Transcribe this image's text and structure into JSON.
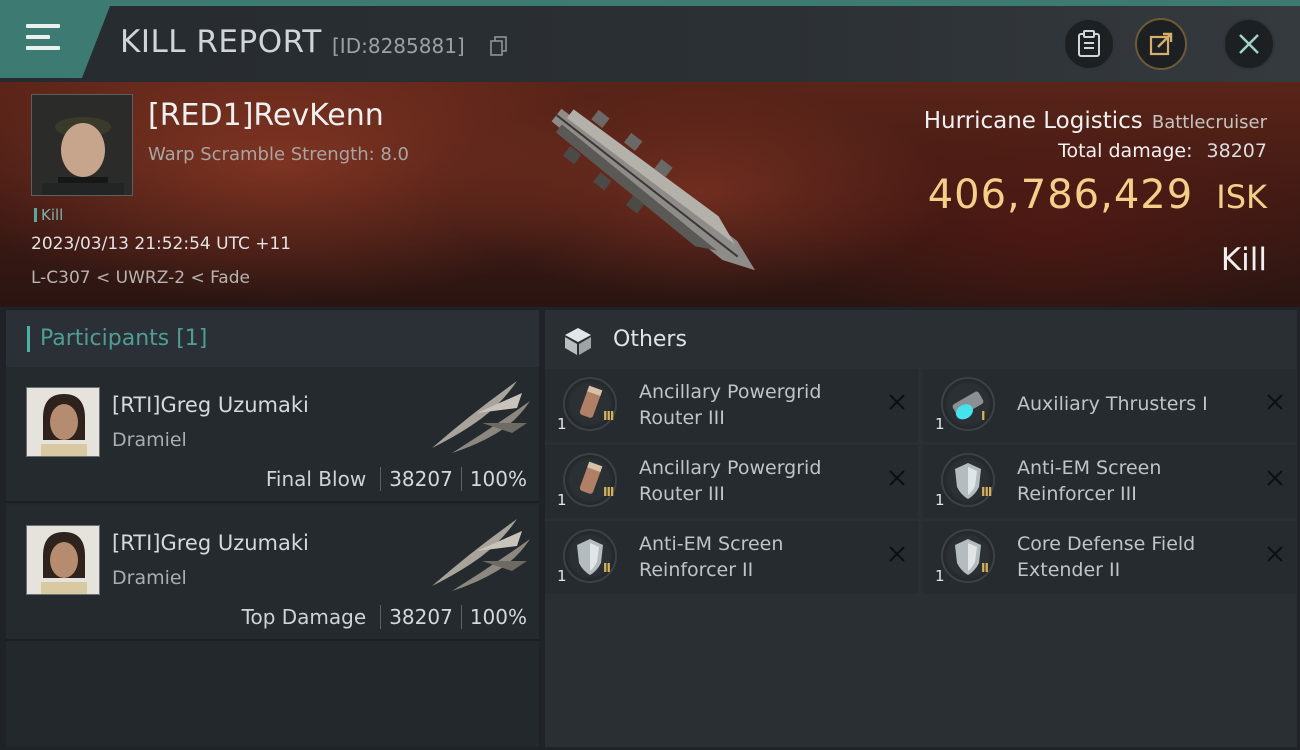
{
  "header": {
    "title": "KILL REPORT",
    "report_id": "[ID:8285881]",
    "icons": [
      "menu-icon",
      "copy-icon",
      "clipboard-icon",
      "share-icon",
      "close-icon"
    ]
  },
  "victim": {
    "name": "[RED1]RevKenn",
    "subtitle": "Warp Scramble Strength: 8.0",
    "tag": "Kill",
    "timestamp": "2023/03/13 21:52:54 UTC +11",
    "location": "L-C307 < UWRZ-2 < Fade"
  },
  "ship": {
    "name": "Hurricane Logistics",
    "class": "Battlecruiser",
    "total_damage_label": "Total damage:",
    "total_damage_value": "38207",
    "isk_value": "406,786,429",
    "isk_unit": "ISK",
    "result": "Kill"
  },
  "participants": {
    "title": "Participants [1]",
    "items": [
      {
        "name": "[RTI]Greg Uzumaki",
        "ship": "Dramiel",
        "role": "Final Blow",
        "damage": "38207",
        "percent": "100%"
      },
      {
        "name": "[RTI]Greg Uzumaki",
        "ship": "Dramiel",
        "role": "Top Damage",
        "damage": "38207",
        "percent": "100%"
      }
    ]
  },
  "others": {
    "title": "Others",
    "items": [
      {
        "name": "Ancillary Powergrid Router III",
        "qty": "1",
        "tier": "III",
        "icon": "powergrid-router-icon"
      },
      {
        "name": "Auxiliary Thrusters I",
        "qty": "1",
        "tier": "I",
        "icon": "thruster-icon"
      },
      {
        "name": "Ancillary Powergrid Router III",
        "qty": "1",
        "tier": "III",
        "icon": "powergrid-router-icon"
      },
      {
        "name": "Anti-EM Screen Reinforcer III",
        "qty": "1",
        "tier": "III",
        "icon": "shield-reinforcer-icon"
      },
      {
        "name": "Anti-EM Screen Reinforcer II",
        "qty": "1",
        "tier": "II",
        "icon": "shield-reinforcer-icon"
      },
      {
        "name": "Core Defense Field Extender II",
        "qty": "1",
        "tier": "II",
        "icon": "shield-extender-icon"
      }
    ]
  },
  "colors": {
    "accent": "#3d7a72",
    "isk": "#f3cf8a",
    "participants_title": "#4f9e96"
  }
}
